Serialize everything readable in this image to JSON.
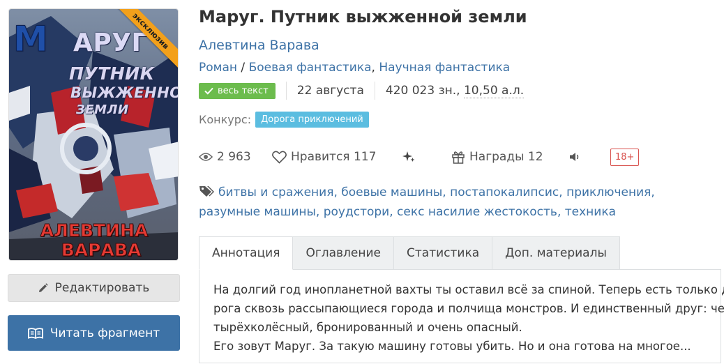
{
  "book": {
    "title": "Маруг. Путник выжженной земли",
    "author": "Алевтина Варава",
    "genres": {
      "form": "Роман",
      "separator": " / ",
      "items": [
        "Боевая фантастика",
        "Научная фантастика"
      ],
      "joiner": ", "
    }
  },
  "cover": {
    "title_m": "М",
    "title_ar": "АРУГ",
    "title_line2": "ПУТНИК",
    "title_line3": "ВЫЖЖЕННОЙ",
    "title_line4": "ЗЕМЛИ",
    "author_line1": "АЛЕВТИНА",
    "author_line2": "ВАРАВА",
    "ribbon": "эксклюзив"
  },
  "buttons": {
    "edit": "Редактировать",
    "read": "Читать фрагмент"
  },
  "meta": {
    "full_text_badge": "весь текст",
    "date": "22 августа",
    "size_prefix": "420 023 зн., ",
    "size_al": "10,50 а.л."
  },
  "contest": {
    "label": "Конкурс:",
    "name": "Дорога приключений"
  },
  "stats": {
    "views": "2 963",
    "likes_label": "Нравится 117",
    "awards_label": "Награды 12",
    "age_rating": "18+"
  },
  "tags": {
    "items": [
      "битвы и сражения",
      "боевые машины",
      "постапокалипсис",
      "приключения",
      "разумные машины",
      "роудстори",
      "секс насилие жестокость",
      "техника"
    ]
  },
  "tabs": [
    "Аннотация",
    "Оглавление",
    "Статистика",
    "Доп. материалы"
  ],
  "annotation": {
    "lines": [
      "На долгий год инопланетной вахты ты оставил всё за спиной. Теперь есть только до-",
      "рога сквозь рассыпающиеся города и полчища монстров. И единственный друг: че-",
      "тырёхколёсный, бронированный и очень опасный.",
      "Его зовут Маруг. За такую машину готовы убить. Но и она готова на многое..."
    ]
  },
  "colors": {
    "link": "#3d72a6",
    "full_text_badge": "#6cbc4d",
    "contest_badge": "#5bbde0",
    "age_badge": "#d9534f",
    "read_button": "#3d72a6",
    "ribbon": "#f3a01b"
  },
  "icons": {
    "full_text": "check-icon",
    "edit": "pencil-icon",
    "read": "open-book-icon",
    "views": "eye-icon",
    "likes": "heart-icon",
    "sparkle": "sparkles-icon",
    "awards": "gift-icon",
    "audio": "speaker-icon",
    "tags": "tags-icon"
  }
}
